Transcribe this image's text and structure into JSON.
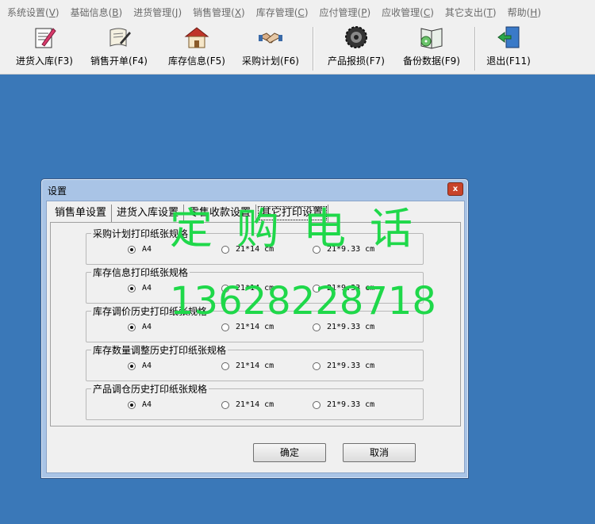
{
  "menubar": {
    "items": [
      {
        "label": "系统设置(",
        "key": "V",
        "end": ")"
      },
      {
        "label": "基础信息(",
        "key": "B",
        "end": ")"
      },
      {
        "label": "进货管理(",
        "key": "J",
        "end": ")"
      },
      {
        "label": "销售管理(",
        "key": "X",
        "end": ")"
      },
      {
        "label": "库存管理(",
        "key": "C",
        "end": ")"
      },
      {
        "label": "应付管理(",
        "key": "P",
        "end": ")"
      },
      {
        "label": "应收管理(",
        "key": "C",
        "end": ")"
      },
      {
        "label": "其它支出(",
        "key": "T",
        "end": ")"
      },
      {
        "label": "帮助(",
        "key": "H",
        "end": ")"
      }
    ]
  },
  "toolbar": {
    "buttons": [
      {
        "label": "进货入库(F3)",
        "icon": "pencil-document-icon"
      },
      {
        "label": "销售开单(F4)",
        "icon": "scroll-pen-icon"
      },
      {
        "label": "库存信息(F5)",
        "icon": "house-icon"
      },
      {
        "label": "采购计划(F6)",
        "icon": "handshake-icon"
      },
      {
        "label": "产品报损(F7)",
        "icon": "gear-icon"
      },
      {
        "label": "备份数据(F9)",
        "icon": "book-disc-icon"
      },
      {
        "label": "退出(F11)",
        "icon": "exit-door-icon"
      }
    ]
  },
  "dialog": {
    "title": "设置",
    "close_label": "x",
    "tabs": [
      {
        "label": "销售单设置"
      },
      {
        "label": "进货入库设置"
      },
      {
        "label": "零售收款设置"
      },
      {
        "label": "其它打印设置"
      }
    ],
    "active_tab": 3,
    "groups": [
      {
        "title": "采购计划打印纸张规格",
        "options": [
          "A4",
          "21*14 cm",
          "21*9.33 cm"
        ],
        "selected": 0
      },
      {
        "title": "库存信息打印纸张规格",
        "options": [
          "A4",
          "21*14 cm",
          "21*9.33 cm"
        ],
        "selected": 0
      },
      {
        "title": "库存调价历史打印纸张规格",
        "options": [
          "A4",
          "21*14 cm",
          "21*9.33 cm"
        ],
        "selected": 0
      },
      {
        "title": "库存数量调整历史打印纸张规格",
        "options": [
          "A4",
          "21*14 cm",
          "21*9.33 cm"
        ],
        "selected": 0
      },
      {
        "title": "产品调仓历史打印纸张规格",
        "options": [
          "A4",
          "21*14 cm",
          "21*9.33 cm"
        ],
        "selected": 0
      }
    ],
    "ok_label": "确定",
    "cancel_label": "取消"
  },
  "watermark": {
    "line1": "定购电话",
    "line2": "13628228718",
    "color": "#1fd84a"
  },
  "colors": {
    "desktop": "#3a78b8",
    "dialog_frame": "#a9c4e6",
    "close_button": "#c8432a"
  }
}
